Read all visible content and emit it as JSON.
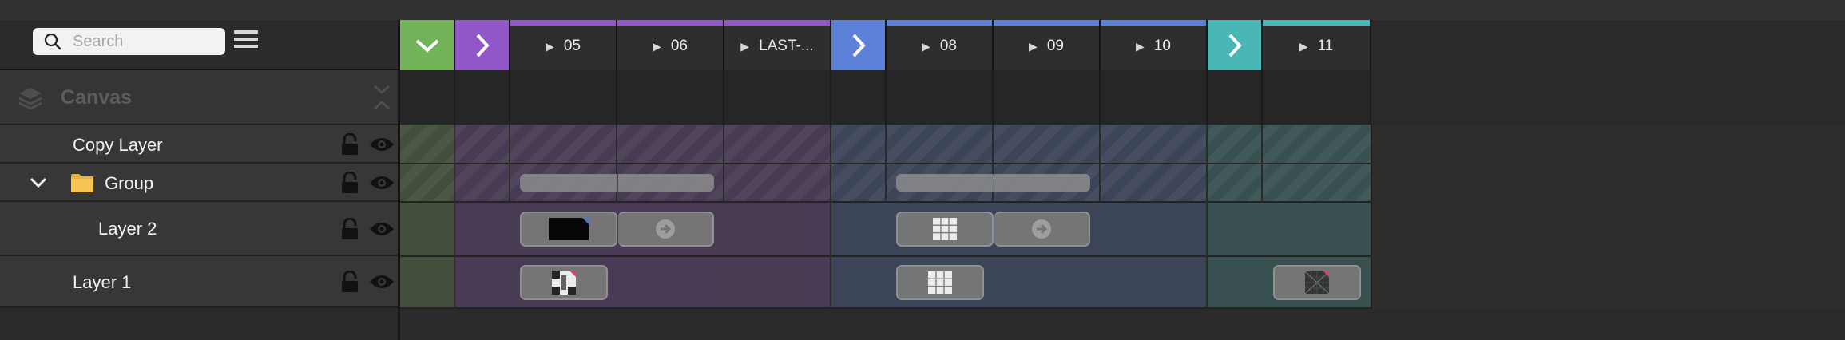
{
  "search": {
    "placeholder": "Search"
  },
  "canvas": {
    "title": "Canvas"
  },
  "layers": [
    {
      "name": "Copy Layer"
    },
    {
      "name": "Group",
      "expanded": true,
      "icon": "folder-icon"
    },
    {
      "name": "Layer 2"
    },
    {
      "name": "Layer 1"
    }
  ],
  "cues": [
    {
      "label": "",
      "kind": "check",
      "color": "#73b35a"
    },
    {
      "label": "",
      "kind": "chevron",
      "color": "#9156c8"
    },
    {
      "label": "05",
      "kind": "cue",
      "color": "#9156c8"
    },
    {
      "label": "06",
      "kind": "cue",
      "color": "#9156c8"
    },
    {
      "label": "LAST-...",
      "kind": "cue",
      "color": "#9156c8"
    },
    {
      "label": "",
      "kind": "chevron",
      "color": "#5c7fd8"
    },
    {
      "label": "08",
      "kind": "cue",
      "color": "#5c7fd8"
    },
    {
      "label": "09",
      "kind": "cue",
      "color": "#5c7fd8"
    },
    {
      "label": "10",
      "kind": "cue",
      "color": "#5c7fd8"
    },
    {
      "label": "",
      "kind": "chevron",
      "color": "#4ab7b7"
    },
    {
      "label": "11",
      "kind": "cue",
      "color": "#4ab7b7"
    }
  ],
  "groups": [
    {
      "name": "green",
      "color": "#73b35a"
    },
    {
      "name": "purple",
      "color": "#9156c8"
    },
    {
      "name": "blue",
      "color": "#5c7fd8"
    },
    {
      "name": "teal",
      "color": "#4ab7b7"
    }
  ]
}
